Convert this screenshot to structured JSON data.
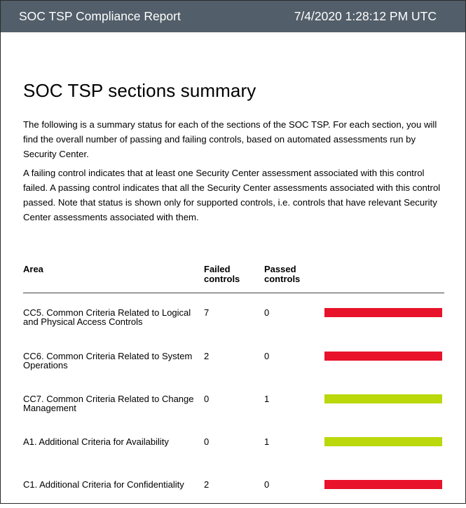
{
  "header": {
    "title": "SOC TSP Compliance Report",
    "timestamp": "7/4/2020 1:28:12 PM UTC"
  },
  "main": {
    "heading": "SOC TSP sections summary",
    "paragraphs": [
      "The following is a summary status for each of the sections of the SOC TSP. For each section, you will find the overall number of passing and failing controls, based on automated assessments run by Security Center.",
      "A failing control indicates that at least one Security Center assessment associated with this control failed. A passing control indicates that all the Security Center assessments associated with this control passed. Note that status is shown only for supported controls, i.e. controls that have relevant Security Center assessments associated with them."
    ],
    "table": {
      "columns": [
        "Area",
        "Failed controls",
        "Passed controls",
        ""
      ],
      "column_lines": [
        [
          "Area"
        ],
        [
          "Failed",
          "controls"
        ],
        [
          "Passed",
          "controls"
        ]
      ],
      "status_colors": {
        "failed": "#e8132a",
        "passed": "#bad80a"
      },
      "rows": [
        {
          "area": "CC5. Common Criteria Related to Logical and Physical Access Controls",
          "failed": "7",
          "passed": "0",
          "status": "failed",
          "bar_color": "#e8132a"
        },
        {
          "area": "CC6. Common Criteria Related to System Operations",
          "failed": "2",
          "passed": "0",
          "status": "failed",
          "bar_color": "#e8132a"
        },
        {
          "area": "CC7. Common Criteria Related to Change Management",
          "failed": "0",
          "passed": "1",
          "status": "passed",
          "bar_color": "#bad80a"
        },
        {
          "area": "A1. Additional Criteria for Availability",
          "failed": "0",
          "passed": "1",
          "status": "passed",
          "bar_color": "#bad80a"
        },
        {
          "area": "C1. Additional Criteria for Confidentiality",
          "failed": "2",
          "passed": "0",
          "status": "failed",
          "bar_color": "#e8132a"
        }
      ]
    }
  }
}
